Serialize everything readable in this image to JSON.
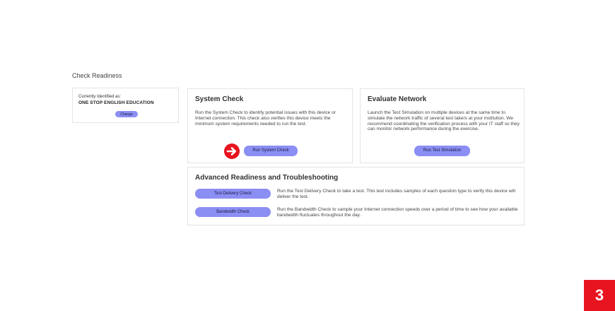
{
  "page": {
    "title": "Check Readiness"
  },
  "identity": {
    "label": "Currently Identified as:",
    "name": "ONE STOP ENGLISH EDUCATION",
    "change_label": "Change"
  },
  "system_check": {
    "title": "System Check",
    "description": "Run the System Check to identify potential issues with this device or Internet connection. This check also verifies this device meets the minimum system requirements needed to run the test.",
    "button_label": "Run System Check"
  },
  "evaluate_network": {
    "title": "Evaluate Network",
    "description": "Launch the Test Simulation on multiple devices at the same time to simulate the network traffic of several test takers at your institution. We recommend coordinating the verification process with your IT staff so they can monitor network performance during the exercise.",
    "button_label": "Run Test Simulation"
  },
  "advanced": {
    "title": "Advanced Readiness and Troubleshooting",
    "items": [
      {
        "button_label": "Test Delivery Check",
        "description": "Run the Test Delivery Check to take a test. This test includes samples of each question type to verify this device will deliver the test."
      },
      {
        "button_label": "Bandwidth Check",
        "description": "Run the Bandwidth Check to sample your Internet connection speeds over a period of time to see how your available bandwidth fluctuates throughout the day."
      }
    ]
  },
  "step_badge": "3",
  "colors": {
    "button": "#8b8ef2",
    "arrow": "#e8141f",
    "badge": "#e8141f"
  },
  "icons": {
    "pointer": "arrow-right-circle-icon"
  }
}
